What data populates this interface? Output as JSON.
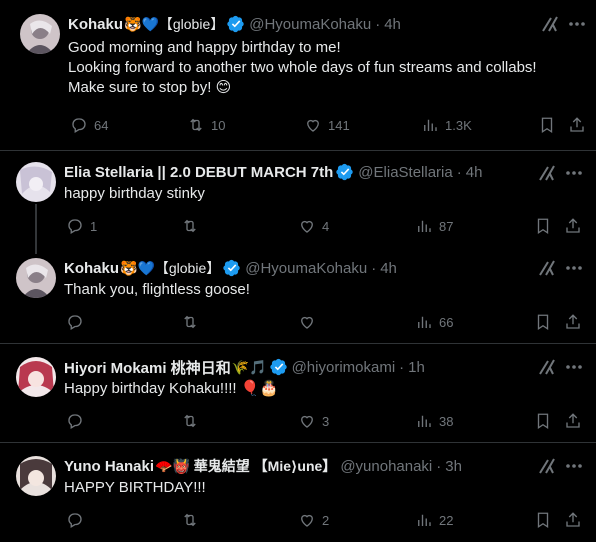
{
  "posts": [
    {
      "name": "Kohaku",
      "name_emoji": "🐯💙【globie】",
      "handle": "@HyoumaKohaku",
      "time": "4h",
      "text": "Good morning and happy birthday to me!\nLooking forward to another two whole days of fun streams and collabs!\nMake sure to stop by! 😊",
      "replies": "64",
      "reposts": "10",
      "likes": "141",
      "views": "1.3K"
    },
    {
      "name": "Elia Stellaria || 2.0 DEBUT MARCH 7th",
      "name_emoji": "",
      "handle": "@EliaStellaria",
      "time": "4h",
      "text": "happy birthday stinky",
      "replies": "1",
      "reposts": "",
      "likes": "4",
      "views": "87"
    },
    {
      "name": "Kohaku",
      "name_emoji": "🐯💙【globie】",
      "handle": "@HyoumaKohaku",
      "time": "4h",
      "text": "Thank you, flightless goose!",
      "replies": "",
      "reposts": "",
      "likes": "",
      "views": "66"
    },
    {
      "name": "Hiyori Mokami 桃神日和",
      "name_emoji": "🌾🎵",
      "handle": "@hiyorimokami",
      "time": "1h",
      "text": "Happy birthday Kohaku!!!! 🎈🎂",
      "replies": "",
      "reposts": "",
      "likes": "3",
      "views": "38"
    },
    {
      "name": "Yuno Hanaki",
      "name_emoji": "🪭👹 華鬼結望 【Mie⟩une】",
      "handle": "@yunohanaki",
      "time": "3h",
      "text": "HAPPY BIRTHDAY!!!",
      "replies": "",
      "reposts": "",
      "likes": "2",
      "views": "22"
    }
  ],
  "dot": "·",
  "colors": {
    "verified": "#1d9bf0",
    "muted": "#71767b",
    "text": "#e7e9ea",
    "bg": "#000000",
    "divider": "#2f3336"
  },
  "icons": [
    "reply-icon",
    "repost-icon",
    "like-icon",
    "views-icon",
    "bookmark-icon",
    "share-icon",
    "grok-icon",
    "more-icon",
    "verified-badge-icon"
  ]
}
